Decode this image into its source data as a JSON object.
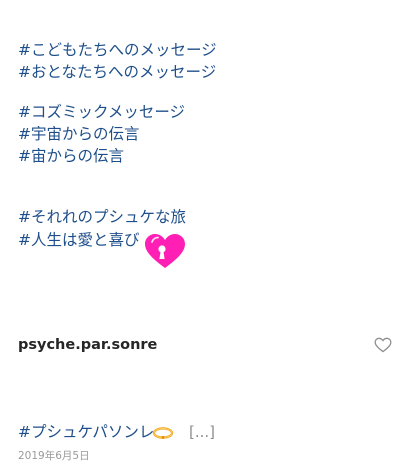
{
  "caption": {
    "lines": [
      "#こどもたちへのメッセージ",
      "#おとなたちへのメッセージ",
      "#コズミックメッセージ",
      "#宇宙からの伝言",
      "#宙からの伝言",
      "#それれのプシュケな旅",
      "#人生は愛と喜び"
    ],
    "heart_emoji": "pink-heart-with-keyhole"
  },
  "post": {
    "username": "psyche.par.sonre",
    "like_icon": "heart-outline-icon",
    "tag": "#プシュケパソンレ",
    "tag_emoji": "bracelet",
    "more": "[...]",
    "date": "2019年6月5日"
  },
  "colors": {
    "hashtag": "#1f4f8a",
    "heart": "#ff1fb4",
    "username": "#262626",
    "muted": "#8e8e8e"
  }
}
